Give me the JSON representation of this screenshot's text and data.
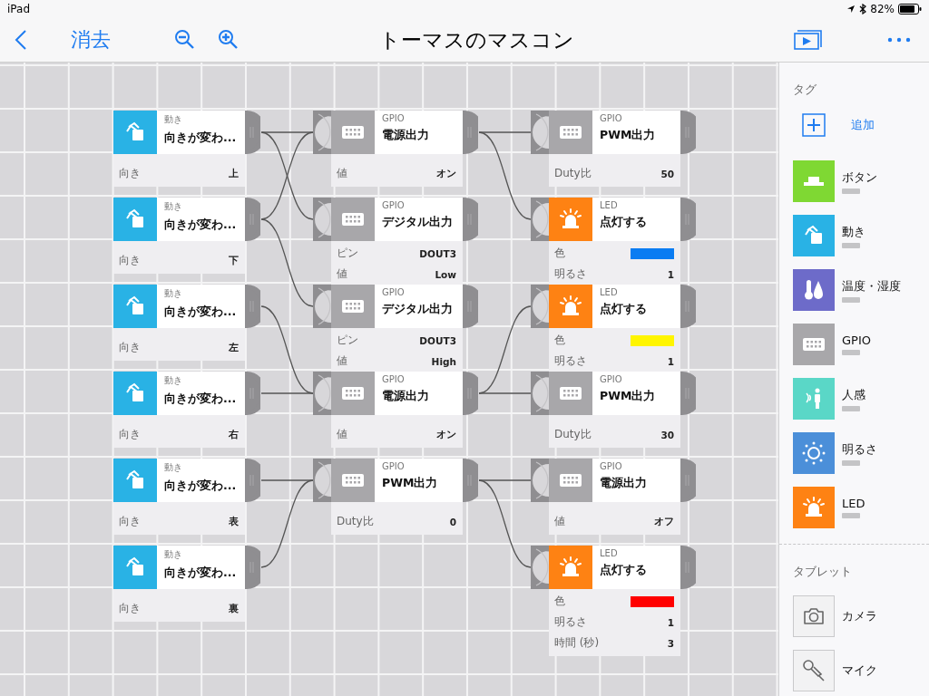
{
  "status_bar": {
    "device": "iPad",
    "battery": "82%"
  },
  "nav_bar": {
    "clear_button": "消去",
    "title": "トーマスのマスコン"
  },
  "canvas": {
    "columns": [
      {
        "nodes": [
          {
            "kind": "motion",
            "category": "動き",
            "title": "向きが変わ...",
            "params": [
              {
                "kind": "text",
                "label": "向き",
                "value": "上"
              }
            ]
          },
          {
            "kind": "motion",
            "category": "動き",
            "title": "向きが変わ...",
            "params": [
              {
                "kind": "text",
                "label": "向き",
                "value": "下"
              }
            ]
          },
          {
            "kind": "motion",
            "category": "動き",
            "title": "向きが変わ...",
            "params": [
              {
                "kind": "text",
                "label": "向き",
                "value": "左"
              }
            ]
          },
          {
            "kind": "motion",
            "category": "動き",
            "title": "向きが変わ...",
            "params": [
              {
                "kind": "text",
                "label": "向き",
                "value": "右"
              }
            ]
          },
          {
            "kind": "motion",
            "category": "動き",
            "title": "向きが変わ...",
            "params": [
              {
                "kind": "text",
                "label": "向き",
                "value": "表"
              }
            ]
          },
          {
            "kind": "motion",
            "category": "動き",
            "title": "向きが変わ...",
            "params": [
              {
                "kind": "text",
                "label": "向き",
                "value": "裏"
              }
            ]
          }
        ]
      },
      {
        "nodes": [
          {
            "kind": "gpio",
            "category": "GPIO",
            "title": "電源出力",
            "params": [
              {
                "kind": "text",
                "label": "値",
                "value": "オン"
              }
            ]
          },
          {
            "kind": "gpio",
            "category": "GPIO",
            "title": "デジタル出力",
            "params": [
              {
                "kind": "text",
                "label": "ピン",
                "value": "DOUT3"
              },
              {
                "kind": "text",
                "label": "値",
                "value": "Low"
              }
            ]
          },
          {
            "kind": "gpio",
            "category": "GPIO",
            "title": "デジタル出力",
            "params": [
              {
                "kind": "text",
                "label": "ピン",
                "value": "DOUT3"
              },
              {
                "kind": "text",
                "label": "値",
                "value": "High"
              }
            ]
          },
          {
            "kind": "gpio",
            "category": "GPIO",
            "title": "電源出力",
            "params": [
              {
                "kind": "text",
                "label": "値",
                "value": "オン"
              }
            ]
          },
          {
            "kind": "gpio",
            "category": "GPIO",
            "title": "PWM出力",
            "params": [
              {
                "kind": "text",
                "label": "Duty比",
                "value": "0"
              }
            ]
          }
        ]
      },
      {
        "nodes": [
          {
            "kind": "gpio",
            "category": "GPIO",
            "title": "PWM出力",
            "params": [
              {
                "kind": "text",
                "label": "Duty比",
                "value": "50"
              }
            ]
          },
          {
            "kind": "led",
            "category": "LED",
            "title": "点灯する",
            "params": [
              {
                "kind": "color",
                "label": "色",
                "color": "#0a7cf2"
              },
              {
                "kind": "text",
                "label": "明るさ",
                "value": "1"
              }
            ]
          },
          {
            "kind": "led",
            "category": "LED",
            "title": "点灯する",
            "params": [
              {
                "kind": "color",
                "label": "色",
                "color": "#fff500"
              },
              {
                "kind": "text",
                "label": "明るさ",
                "value": "1"
              }
            ]
          },
          {
            "kind": "gpio",
            "category": "GPIO",
            "title": "PWM出力",
            "params": [
              {
                "kind": "text",
                "label": "Duty比",
                "value": "30"
              }
            ]
          },
          {
            "kind": "gpio",
            "category": "GPIO",
            "title": "電源出力",
            "params": [
              {
                "kind": "text",
                "label": "値",
                "value": "オフ"
              }
            ]
          },
          {
            "kind": "led",
            "category": "LED",
            "title": "点灯する",
            "params": [
              {
                "kind": "color",
                "label": "色",
                "color": "#ff0000"
              },
              {
                "kind": "text",
                "label": "明るさ",
                "value": "1"
              },
              {
                "kind": "text",
                "label": "時間 (秒)",
                "value": "3"
              }
            ]
          }
        ]
      }
    ]
  },
  "sidebar": {
    "tags_heading": "タグ",
    "add_label": "追加",
    "tags": [
      {
        "kind": "button",
        "label": "ボタン"
      },
      {
        "kind": "motion",
        "label": "動き"
      },
      {
        "kind": "temperature",
        "label": "温度・湿度"
      },
      {
        "kind": "gpio",
        "label": "GPIO"
      },
      {
        "kind": "human",
        "label": "人感"
      },
      {
        "kind": "brightness",
        "label": "明るさ"
      },
      {
        "kind": "led",
        "label": "LED"
      }
    ],
    "tablet_heading": "タブレット",
    "tablet": [
      {
        "kind": "camera",
        "label": "カメラ"
      },
      {
        "kind": "mic",
        "label": "マイク"
      }
    ]
  }
}
